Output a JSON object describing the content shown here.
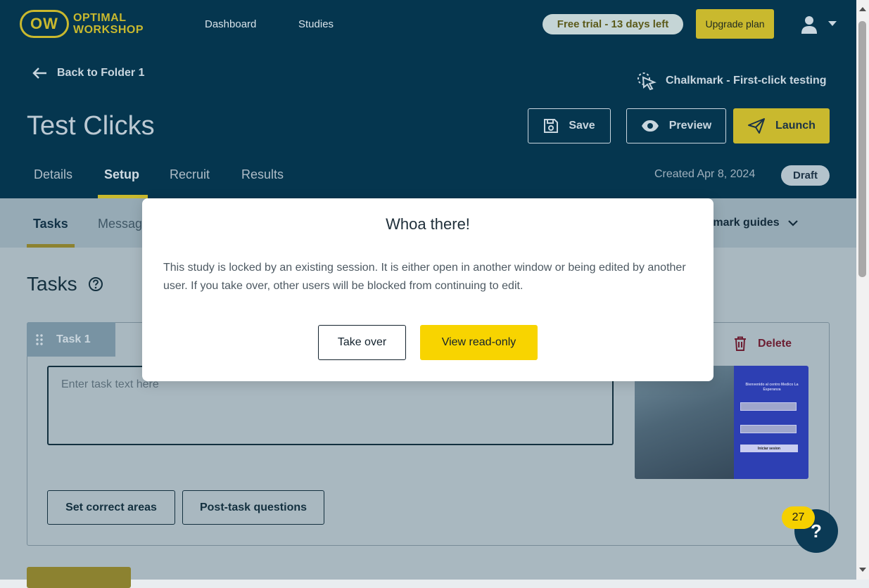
{
  "topnav": {
    "logo_mark": "OW",
    "logo_line1": "OPTIMAL",
    "logo_line2": "WORKSHOP",
    "links": [
      "Dashboard",
      "Studies"
    ],
    "trial_badge": "Free trial - 13 days left",
    "upgrade_label": "Upgrade plan",
    "user_icon": "user-icon"
  },
  "header": {
    "back_label": "Back to Folder 1",
    "study_type": "Chalkmark - First-click testing",
    "title": "Test Clicks",
    "save_label": "Save",
    "preview_label": "Preview",
    "launch_label": "Launch",
    "tabs": [
      "Details",
      "Setup",
      "Recruit",
      "Results"
    ],
    "active_tab": "Setup",
    "created": "Created Apr 8, 2024",
    "status": "Draft"
  },
  "subtabs": {
    "items": [
      "Tasks",
      "Messag"
    ],
    "guides_label": "lkmark guides"
  },
  "tasks": {
    "heading": "Tasks",
    "task": {
      "label": "Task 1",
      "placeholder": "Enter task text here",
      "delete_label": "Delete",
      "thumb_title": "Bienvenido al centro Medico La Esperanza",
      "thumb_button": "Iniciar sesion",
      "set_correct_label": "Set correct areas",
      "post_task_label": "Post-task questions"
    }
  },
  "help_widget": {
    "count": "27",
    "symbol": "?"
  },
  "modal": {
    "title": "Whoa there!",
    "body": "This study is locked by an existing session. It is either open in another window or being edited by another user. If you take over, other users will be blocked from continuing to edit.",
    "take_over_label": "Take over",
    "read_only_label": "View read-only"
  },
  "colors": {
    "navy": "#05364f",
    "accent_yellow": "#f8d400",
    "olive_accent": "#c9b92e",
    "delete_red": "#6c1e32"
  }
}
